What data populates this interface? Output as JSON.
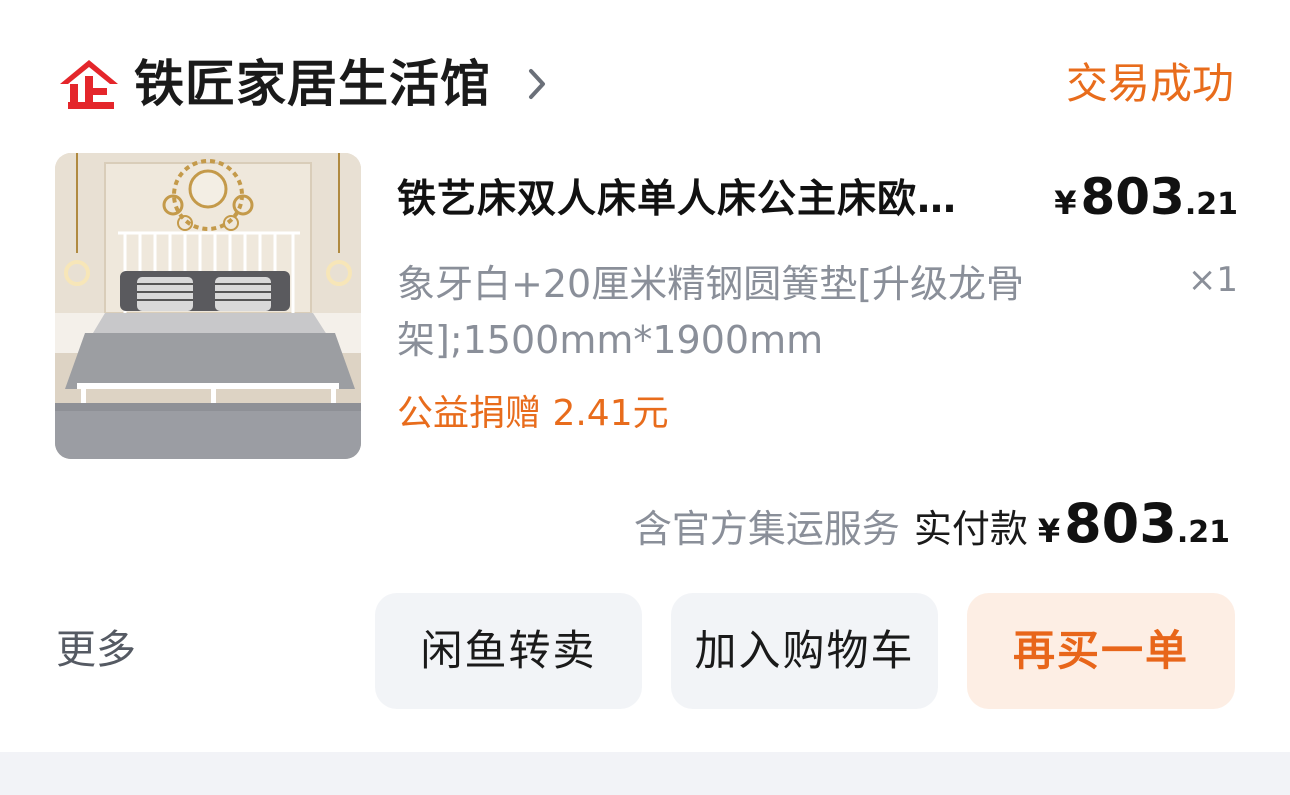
{
  "store": {
    "name": "铁匠家居生活馆",
    "logo_text": "企",
    "status": "交易成功"
  },
  "product": {
    "title": "铁艺床双人床单人床公主床欧…",
    "price_symbol": "¥",
    "price_int": "803",
    "price_dec": ".21",
    "spec": "象牙白+20厘米精钢圆簧垫[升级龙骨架];1500mm*1900mm",
    "quantity": "×1",
    "donation": "公益捐赠 2.41元"
  },
  "totals": {
    "service_note": "含官方集运服务",
    "paid_label": "实付款",
    "symbol": "¥",
    "int": "803",
    "dec": ".21"
  },
  "actions": {
    "more": "更多",
    "resell": "闲鱼转卖",
    "add_to_cart": "加入购物车",
    "buy_again": "再买一单"
  },
  "colors": {
    "accent": "#e86c1c",
    "status": "#e86c1c",
    "logo_red": "#e4262b",
    "muted_text": "#8a8f99",
    "button_bg": "#f2f4f7",
    "primary_button_bg": "#fdeee4"
  }
}
